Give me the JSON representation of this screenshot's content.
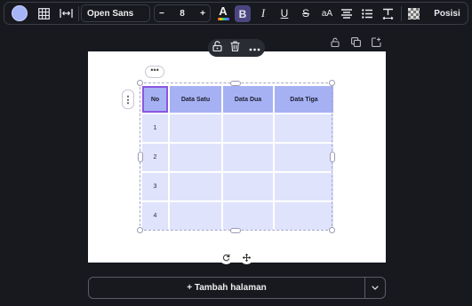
{
  "toolbar": {
    "font_family": "Open Sans",
    "font_size_decrease": "−",
    "font_size": "8",
    "font_size_increase": "+",
    "text_color_letter": "A",
    "bold_label": "B",
    "italic_label": "I",
    "underline_label": "U",
    "strike_label": "S",
    "case_label": "aA",
    "position_label": "Posisi",
    "accent_color": "#a5b4f5",
    "active_bg": "#4b4580"
  },
  "table": {
    "headers": [
      "No",
      "Data Satu",
      "Data Dua",
      "Data Tiga"
    ],
    "rows": [
      [
        "1",
        "",
        "",
        ""
      ],
      [
        "2",
        "",
        "",
        ""
      ],
      [
        "3",
        "",
        "",
        ""
      ],
      [
        "4",
        "",
        "",
        ""
      ]
    ],
    "header_color": "#a6b1f4",
    "cell_color": "#dfe3fb"
  },
  "canvas": {
    "more_label": "•••",
    "side_more_label": "⋮"
  },
  "add_page": {
    "label": "+ Tambah halaman"
  }
}
